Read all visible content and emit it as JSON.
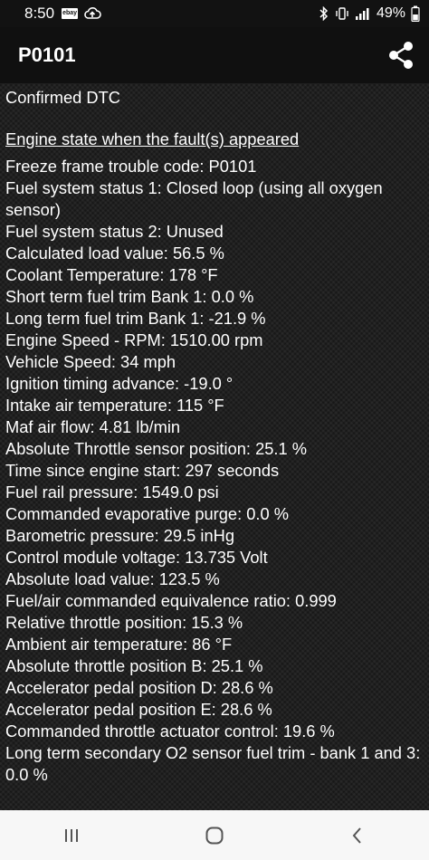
{
  "status_bar": {
    "time": "8:50",
    "ebay_icon_text": "ebay",
    "battery_percent": "49%",
    "icons": [
      "ebay-icon",
      "cloud-upload-icon",
      "bluetooth-icon",
      "vibrate-icon",
      "signal-icon",
      "battery-icon"
    ]
  },
  "toolbar": {
    "title": "P0101",
    "share_icon": "share-icon"
  },
  "content": {
    "dtc_type": "Confirmed DTC",
    "section_heading": "Engine state when the fault(s) appeared",
    "lines": [
      "Freeze frame trouble code: P0101",
      "Fuel system status 1: Closed loop (using all oxygen sensor)",
      "Fuel system status 2: Unused",
      "Calculated load value: 56.5 %",
      "Coolant Temperature: 178 °F",
      "Short term fuel trim Bank 1: 0.0 %",
      "Long term fuel trim Bank 1: -21.9 %",
      "Engine Speed - RPM: 1510.00 rpm",
      "Vehicle Speed: 34 mph",
      "Ignition timing advance: -19.0 °",
      "Intake air temperature: 115 °F",
      "Maf air flow: 4.81 lb/min",
      "Absolute Throttle sensor position: 25.1 %",
      "Time since engine start: 297 seconds",
      "Fuel rail pressure: 1549.0 psi",
      "Commanded evaporative purge: 0.0 %",
      "Barometric pressure: 29.5 inHg",
      "Control module voltage: 13.735 Volt",
      "Absolute load value: 123.5 %",
      "Fuel/air commanded equivalence ratio: 0.999",
      "Relative throttle position: 15.3 %",
      "Ambient air temperature: 86 °F",
      "Absolute throttle position B: 25.1 %",
      "Accelerator pedal position D: 28.6 %",
      "Accelerator pedal position E: 28.6 %",
      "Commanded throttle actuator control: 19.6 %",
      "Long term secondary O2 sensor fuel trim - bank 1 and 3: 0.0 %"
    ]
  },
  "nav_bar": {
    "buttons": [
      "recent-apps-icon",
      "home-icon",
      "back-icon"
    ]
  }
}
